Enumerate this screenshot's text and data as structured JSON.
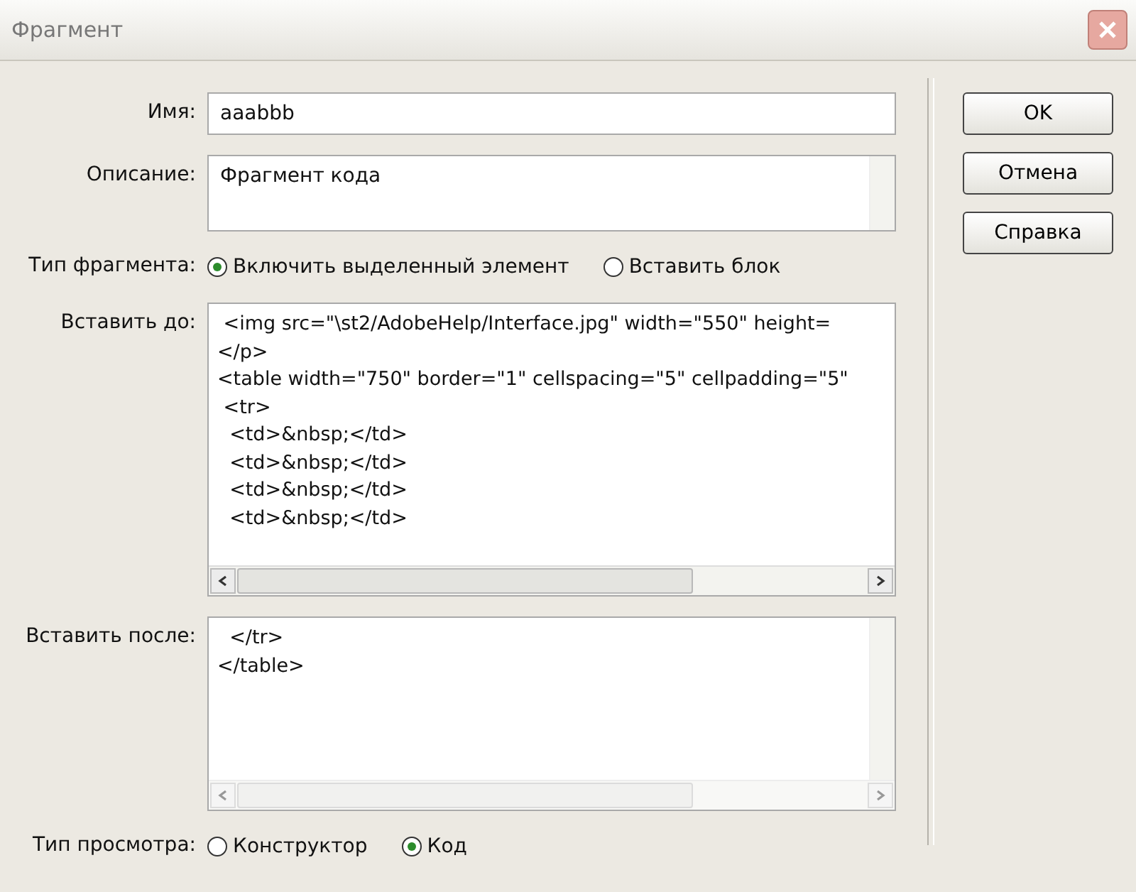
{
  "window": {
    "title": "Фрагмент"
  },
  "name": {
    "label": "Имя:",
    "value": "aaabbb"
  },
  "description": {
    "label": "Описание:",
    "value": "Фрагмент кода"
  },
  "fragment_type": {
    "label": "Тип фрагмента:",
    "options": [
      {
        "label": "Включить выделенный элемент",
        "selected": true
      },
      {
        "label": "Вставить блок",
        "selected": false
      }
    ]
  },
  "insert_before": {
    "label": "Вставить до:",
    "lines": [
      " <img src=\"\\st2/AdobeHelp/Interface.jpg\" width=\"550\" height=",
      "</p>",
      "<table width=\"750\" border=\"1\" cellspacing=\"5\" cellpadding=\"5\"",
      " <tr>",
      "  <td>&nbsp;</td>",
      "  <td>&nbsp;</td>",
      "  <td>&nbsp;</td>",
      "  <td>&nbsp;</td>"
    ]
  },
  "insert_after": {
    "label": "Вставить после:",
    "lines": [
      "  </tr>",
      "</table>"
    ]
  },
  "preview_type": {
    "label": "Тип просмотра:",
    "options": [
      {
        "label": "Конструктор",
        "selected": false
      },
      {
        "label": "Код",
        "selected": true
      }
    ]
  },
  "buttons": [
    "OK",
    "Отмена",
    "Справка"
  ]
}
